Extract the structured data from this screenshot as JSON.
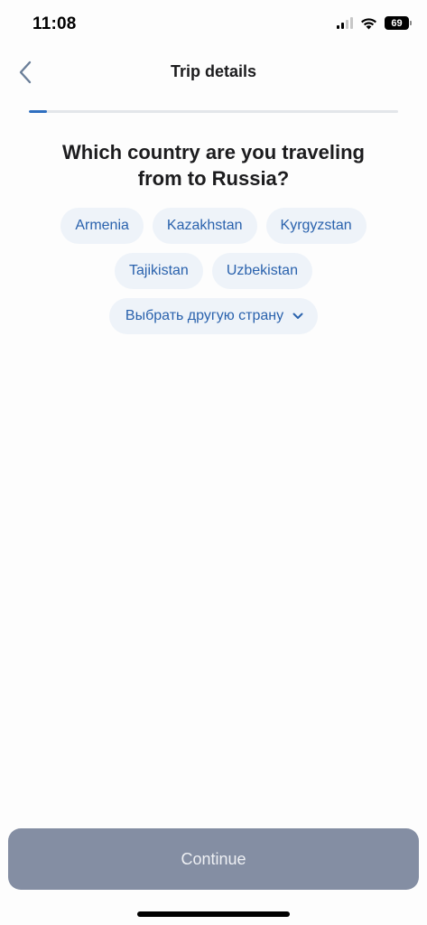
{
  "status_bar": {
    "time": "11:08",
    "battery": "69",
    "icons": [
      "signal-icon",
      "wifi-icon",
      "battery-icon"
    ]
  },
  "header": {
    "title": "Trip details",
    "back_icon": "chevron-left-icon"
  },
  "progress": {
    "fraction": 0.05,
    "fill_color": "#2f6fc0",
    "track_color": "#e3e6ea"
  },
  "question": {
    "line1": "Which country are you traveling",
    "line2": "from to Russia?"
  },
  "options": {
    "row1": [
      "Armenia",
      "Kazakhstan",
      "Kyrgyzstan"
    ],
    "row2": [
      "Tajikistan",
      "Uzbekistan"
    ],
    "other_label": "Выбрать другую страну"
  },
  "colors": {
    "chip_bg": "#eef3f9",
    "chip_text": "#2a62ad",
    "continue_bg": "#848ea3"
  },
  "continue_label": "Continue"
}
